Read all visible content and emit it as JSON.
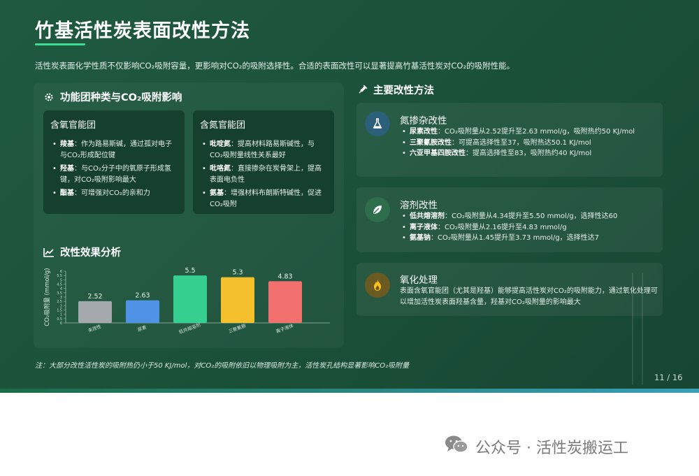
{
  "title": "竹基活性炭表面改性方法",
  "intro": "活性炭表面化学性质不仅影响CO₂吸附容量，更影响对CO₂的吸附选择性。合适的表面改性可以显著提高竹基活性炭对CO₂的吸附性能。",
  "functional_groups": {
    "heading": "功能团种类与CO₂吸附影响",
    "oxygen": {
      "title": "含氧官能团",
      "items": [
        {
          "term": "羧基",
          "desc": "：作为路易斯碱，通过孤对电子与CO₂形成配位键"
        },
        {
          "term": "羟基",
          "desc": "：与CO₂分子中的氧原子形成氢键，对CO₂吸附影响最大"
        },
        {
          "term": "酯基",
          "desc": "：可增强对CO₂的亲和力"
        }
      ]
    },
    "nitrogen": {
      "title": "含氮官能团",
      "items": [
        {
          "term": "吡啶氮",
          "desc": "：提高材料路易斯碱性，与CO₂吸附量线性关系最好"
        },
        {
          "term": "吡咯氮",
          "desc": "：直接掺杂在炭骨架上，提高表面电负性"
        },
        {
          "term": "氨基",
          "desc": "：增强材料布朗斯特碱性，促进CO₂吸附"
        }
      ]
    }
  },
  "effect": {
    "heading": "改性效果分析"
  },
  "chart_data": {
    "type": "bar",
    "categories": [
      "未改性",
      "尿素",
      "低共熔溶剂",
      "三聚氰胺",
      "离子液体"
    ],
    "values": [
      2.52,
      2.63,
      5.5,
      5.3,
      4.83
    ],
    "value_labels": [
      "2.52",
      "2.63",
      "5.5",
      "5.3",
      "4.83"
    ],
    "colors": [
      "#a4a9ad",
      "#4f93e6",
      "#35d08f",
      "#f4c12d",
      "#f2706d"
    ],
    "ylabel": "CO₂吸附量 (mmol/g)",
    "ylim": [
      0,
      6
    ],
    "y_ticks": [
      0,
      0.5,
      1,
      1.5,
      2,
      2.5,
      3,
      3.5,
      4,
      4.5,
      5,
      5.5,
      6
    ],
    "grid": false,
    "legend": "none"
  },
  "methods": {
    "heading": "主要改性方法",
    "nitrogen_doping": {
      "title": "氮掺杂改性",
      "icon": "flask-icon",
      "items": [
        {
          "term": "尿素改性",
          "desc": "：CO₂吸附量从2.52提升至2.63 mmol/g，吸附热约50 KJ/mol"
        },
        {
          "term": "三聚氰胺改性",
          "desc": "：可提高选择性至37，吸附热达50.1 KJ/mol"
        },
        {
          "term": "六亚甲基四胺改性",
          "desc": "：提高选择性至83，吸附热约40 KJ/mol"
        }
      ]
    },
    "solvent": {
      "title": "溶剂改性",
      "icon": "leaf-icon",
      "items": [
        {
          "term": "低共熔溶剂",
          "desc": "：CO₂吸附量从4.34提升至5.50 mmol/g，选择性达60"
        },
        {
          "term": "离子液体",
          "desc": "：CO₂吸附量从2.16提升至4.83 mmol/g"
        },
        {
          "term": "氨基钠",
          "desc": "：CO₂吸附量从1.45提升至3.73 mmol/g，选择性达7"
        }
      ]
    },
    "oxidation": {
      "title": "氧化处理",
      "icon": "flame-icon",
      "text": "表面含氧官能团（尤其是羟基）能够提高活性炭对CO₂的吸附能力，通过氧化处理可以增加活性炭表面羟基含量，羟基对CO₂吸附量的影响最大"
    }
  },
  "note": "注：大部分改性活性炭的吸附热仍小于50 KJ/mol，对CO₂的吸附依旧以物理吸附为主，活性炭孔结构显著影响CO₂吸附量",
  "pager": "11 / 16",
  "watermark": "公众号 · 活性炭搬运工",
  "colors": {
    "background": "#1b5038",
    "accent": "#3ddc97",
    "card": "#15402e"
  }
}
